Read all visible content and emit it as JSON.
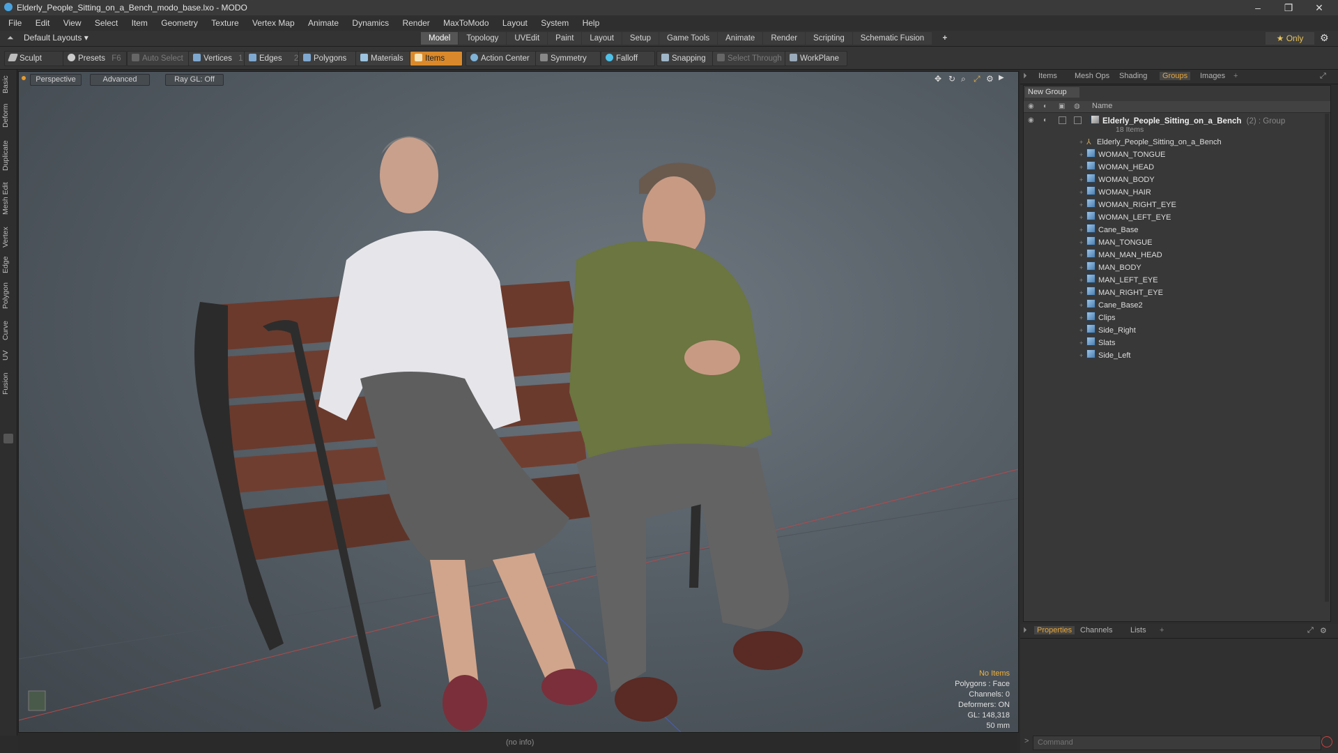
{
  "window": {
    "title": "Elderly_People_Sitting_on_a_Bench_modo_base.lxo - MODO",
    "minimize": "–",
    "restore": "❐",
    "close": "✕"
  },
  "menu": [
    "File",
    "Edit",
    "View",
    "Select",
    "Item",
    "Geometry",
    "Texture",
    "Vertex Map",
    "Animate",
    "Dynamics",
    "Render",
    "MaxToModo",
    "Layout",
    "System",
    "Help"
  ],
  "layoutbar": {
    "layout_select": "Default Layouts ▾",
    "tabs": [
      "Model",
      "Topology",
      "UVEdit",
      "Paint",
      "Layout",
      "Setup",
      "Game Tools",
      "Animate",
      "Render",
      "Scripting",
      "Schematic Fusion"
    ],
    "active_tab": "Model",
    "add_tab": "+",
    "only_label": "★  Only",
    "gear": "⚙"
  },
  "toolbar": {
    "sculpt": "Sculpt",
    "presets": "Presets",
    "presets_key": "F6",
    "auto_select": "Auto Select",
    "vertices": "Vertices",
    "vertices_count": "1",
    "edges": "Edges",
    "edges_count": "2",
    "polygons": "Polygons",
    "materials": "Materials",
    "items": "Items",
    "action_center": "Action Center",
    "symmetry": "Symmetry",
    "falloff": "Falloff",
    "snapping": "Snapping",
    "select_through": "Select Through",
    "workplane": "WorkPlane"
  },
  "left_tabs": [
    "Basic",
    "Deform",
    "Duplicate",
    "Mesh Edit",
    "Vertex",
    "Edge",
    "Polygon",
    "Curve",
    "UV",
    "Fusion"
  ],
  "viewport": {
    "view_mode": "Perspective",
    "shading": "Advanced",
    "raygl": "Ray GL: Off",
    "hud": {
      "selection": "No Items",
      "polygons": "Polygons : Face",
      "channels": "Channels: 0",
      "deformers": "Deformers: ON",
      "gl": "GL: 148,318",
      "focal": "50 mm"
    },
    "status": "(no info)"
  },
  "right_panel": {
    "top_tabs": [
      "Items",
      "Mesh Ops",
      "Shading",
      "Groups",
      "Images"
    ],
    "active_tab": "Groups",
    "new_group": "New Group",
    "col_name": "Name",
    "group": {
      "name": "Elderly_People_Sitting_on_a_Bench",
      "suffix": "(2) : Group",
      "count": "18 Items"
    },
    "items": [
      "Elderly_People_Sitting_on_a_Bench",
      "WOMAN_TONGUE",
      "WOMAN_HEAD",
      "WOMAN_BODY",
      "WOMAN_HAIR",
      "WOMAN_RIGHT_EYE",
      "WOMAN_LEFT_EYE",
      "Cane_Base",
      "MAN_TONGUE",
      "MAN_MAN_HEAD",
      "MAN_BODY",
      "MAN_LEFT_EYE",
      "MAN_RIGHT_EYE",
      "Cane_Base2",
      "Clips",
      "Side_Right",
      "Slats",
      "Side_Left"
    ],
    "bottom_tabs": [
      "Properties",
      "Channels",
      "Lists"
    ],
    "bottom_active": "Properties",
    "command_placeholder": "Command"
  },
  "colors": {
    "accent_orange": "#d9892b",
    "active_tab_text": "#e8a635",
    "hud_highlight": "#f0b23c"
  }
}
